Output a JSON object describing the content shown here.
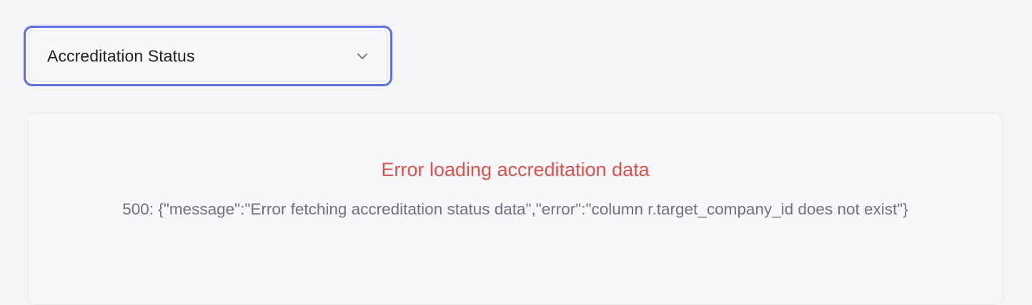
{
  "dropdown": {
    "selected": "Accreditation Status",
    "icon": "chevron-down-icon",
    "focus_color": "#5b6fe0"
  },
  "panel": {
    "error_title": "Error loading accreditation data",
    "error_detail": "500: {\"message\":\"Error fetching accreditation status data\",\"error\":\"column r.target_company_id does not exist\"}",
    "error_color": "#e0504a",
    "detail_color": "#6b7382"
  }
}
